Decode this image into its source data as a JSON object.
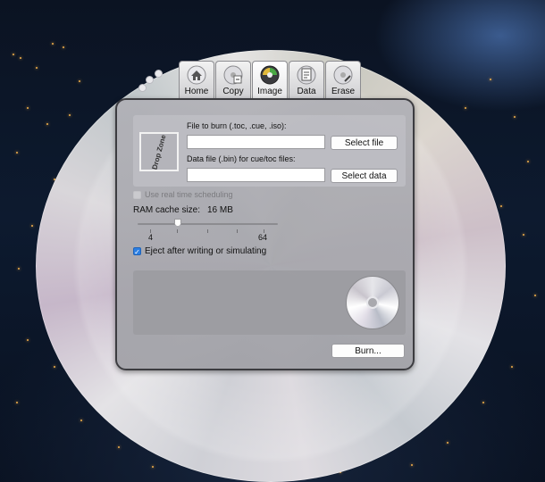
{
  "toolbar": {
    "tabs": [
      {
        "label": "Home",
        "icon": "home-icon"
      },
      {
        "label": "Copy",
        "icon": "copy-icon"
      },
      {
        "label": "Image",
        "icon": "image-icon",
        "active": true
      },
      {
        "label": "Data",
        "icon": "data-icon"
      },
      {
        "label": "Erase",
        "icon": "erase-icon"
      }
    ]
  },
  "image_panel": {
    "drop_zone_label": "Drop Zone",
    "file_to_burn_label": "File to burn (.toc, .cue, .iso):",
    "file_to_burn_value": "",
    "select_file_button": "Select file",
    "data_file_label": "Data file (.bin) for cue/toc files:",
    "data_file_value": "",
    "select_data_button": "Select data",
    "realtime_label": "Use real time scheduling",
    "realtime_checked": false,
    "ram_cache_label": "RAM cache size:",
    "ram_cache_value": "16 MB",
    "slider_min_label": "4",
    "slider_max_label": "64",
    "eject_label": "Eject after writing or simulating",
    "eject_checked": true,
    "burn_button": "Burn..."
  },
  "colors": {
    "accent": "#2c7fe3",
    "city_lights": "#f2b04a"
  }
}
